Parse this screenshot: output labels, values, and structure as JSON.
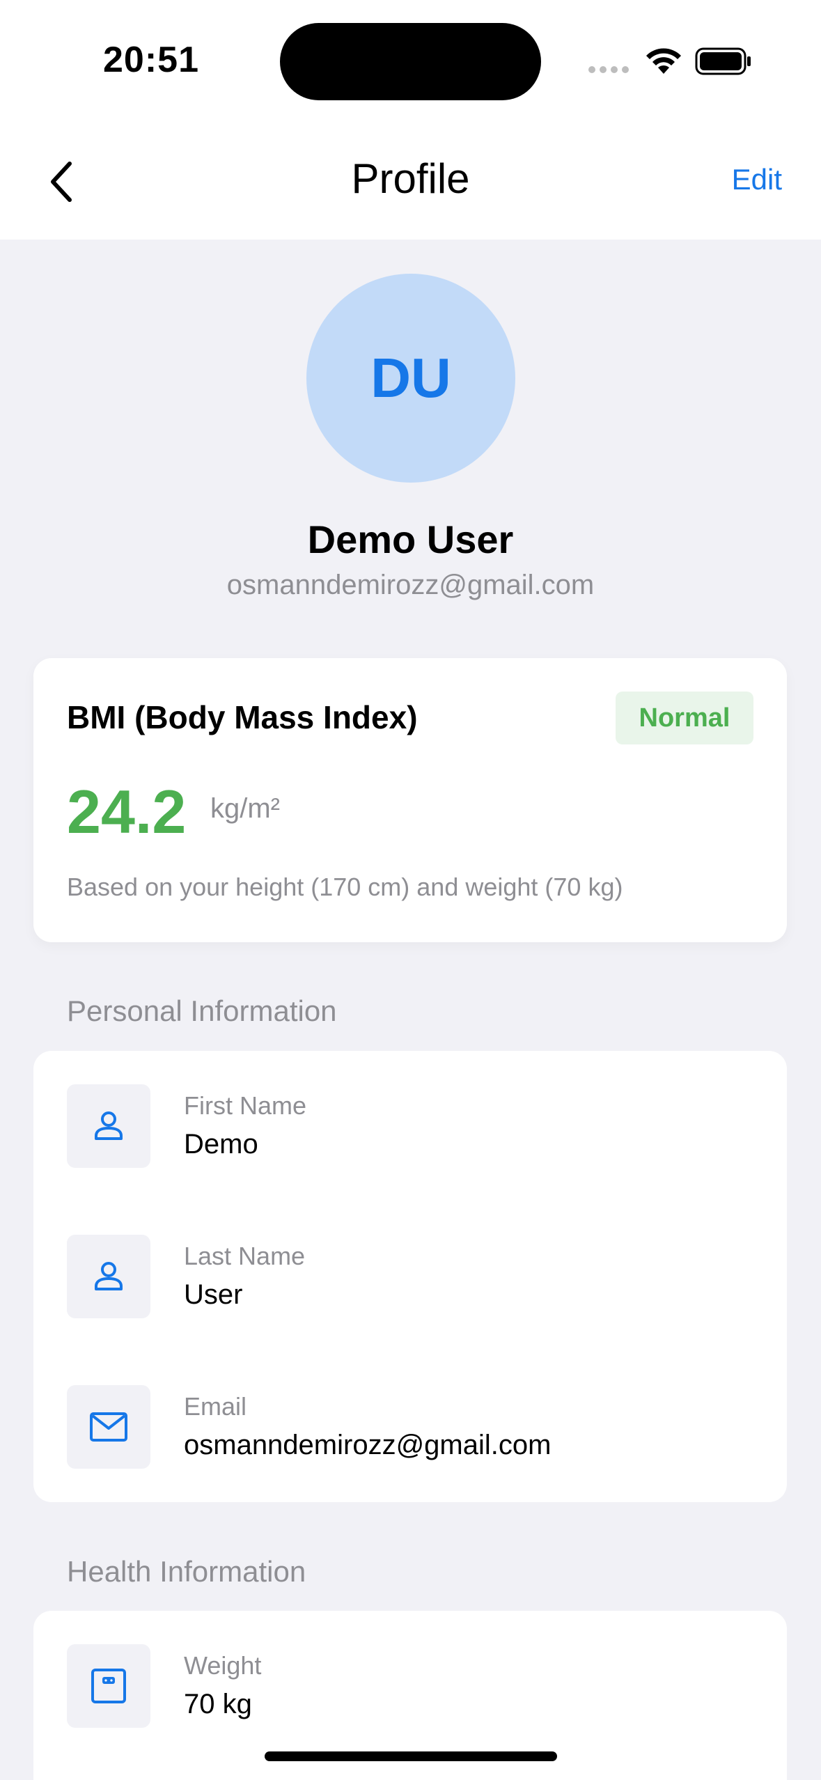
{
  "status_bar": {
    "time": "20:51"
  },
  "nav": {
    "title": "Profile",
    "edit_label": "Edit"
  },
  "profile": {
    "initials": "DU",
    "name": "Demo User",
    "email": "osmanndemirozz@gmail.com"
  },
  "bmi": {
    "title": "BMI (Body Mass Index)",
    "status": "Normal",
    "value": "24.2",
    "unit": "kg/m²",
    "note": "Based on your height (170 cm) and weight (70 kg)"
  },
  "personal": {
    "header": "Personal Information",
    "rows": [
      {
        "label": "First Name",
        "value": "Demo",
        "icon": "person-icon"
      },
      {
        "label": "Last Name",
        "value": "User",
        "icon": "person-icon"
      },
      {
        "label": "Email",
        "value": "osmanndemirozz@gmail.com",
        "icon": "envelope-icon"
      }
    ]
  },
  "health": {
    "header": "Health Information",
    "rows": [
      {
        "label": "Weight",
        "value": "70 kg",
        "icon": "scale-icon"
      }
    ]
  },
  "colors": {
    "accent": "#1677E8",
    "bmi_normal": "#4CAF50",
    "background": "#F1F1F6"
  }
}
